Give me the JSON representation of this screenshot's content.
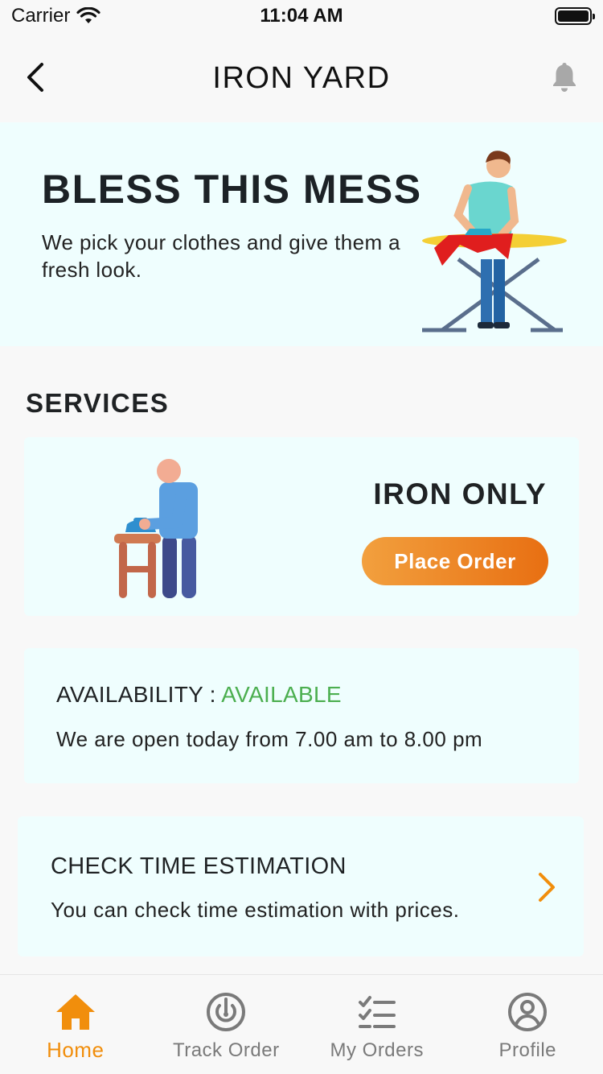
{
  "status_bar": {
    "carrier": "Carrier",
    "time": "11:04 AM"
  },
  "nav": {
    "title": "IRON YARD"
  },
  "hero": {
    "title": "BLESS THIS MESS",
    "subtitle": "We pick your clothes and give them a fresh look."
  },
  "services": {
    "heading": "SERVICES",
    "card": {
      "name": "IRON ONLY",
      "button_label": "Place Order"
    }
  },
  "availability": {
    "label": "AVAILABILITY : ",
    "status": "AVAILABLE",
    "status_color": "#4caf50",
    "hours": "We are open today from 7.00 am to 8.00 pm"
  },
  "time_estimation": {
    "title": "CHECK TIME ESTIMATION",
    "subtitle": "You can check time estimation with prices."
  },
  "tabs": [
    {
      "label": "Home",
      "icon": "home-icon",
      "active": true
    },
    {
      "label": "Track Order",
      "icon": "track-order-icon",
      "active": false
    },
    {
      "label": "My Orders",
      "icon": "checklist-icon",
      "active": false
    },
    {
      "label": "Profile",
      "icon": "profile-icon",
      "active": false
    }
  ],
  "colors": {
    "accent": "#f18e0c",
    "card_bg": "#effefe",
    "inactive_tab": "#7a7a7a"
  }
}
